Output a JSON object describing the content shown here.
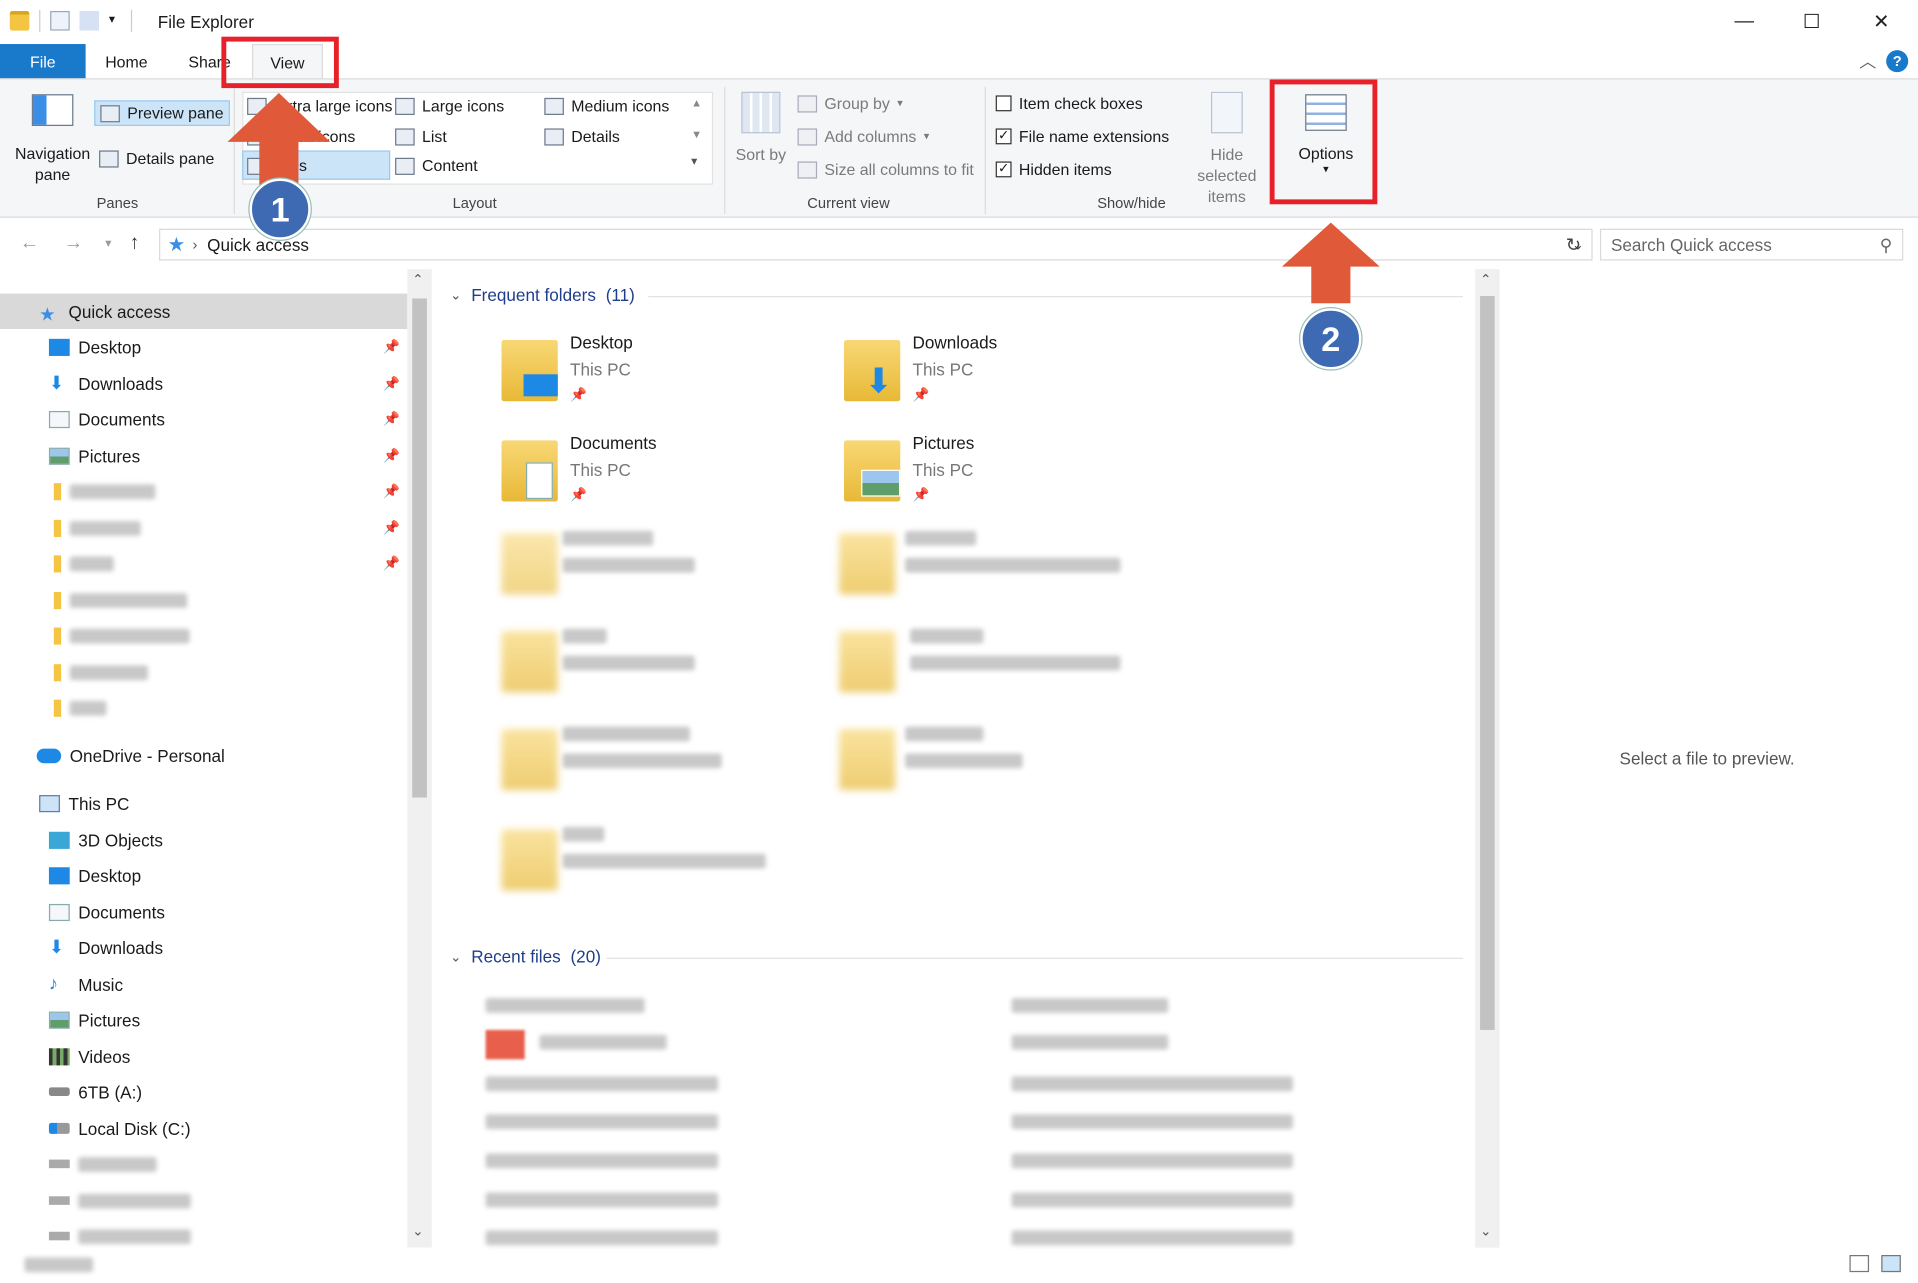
{
  "window": {
    "title": "File Explorer"
  },
  "tabs": {
    "file": "File",
    "home": "Home",
    "share": "Share",
    "view": "View"
  },
  "ribbon": {
    "panes": {
      "label": "Panes",
      "navigation_pane": "Navigation pane",
      "preview_pane": "Preview pane",
      "details_pane": "Details pane"
    },
    "layout": {
      "label": "Layout",
      "items": [
        "Extra large icons",
        "Large icons",
        "Medium icons",
        "Small icons",
        "List",
        "Details",
        "Tiles",
        "Content"
      ]
    },
    "current_view": {
      "label": "Current view",
      "sort_by": "Sort by",
      "group_by": "Group by",
      "add_columns": "Add columns",
      "size_all_columns": "Size all columns to fit"
    },
    "show_hide": {
      "label": "Show/hide",
      "item_check_boxes": {
        "label": "Item check boxes",
        "checked": false
      },
      "file_name_extensions": {
        "label": "File name extensions",
        "checked": true
      },
      "hidden_items": {
        "label": "Hidden items",
        "checked": true
      },
      "hide_selected_items": "Hide selected items"
    },
    "options": "Options"
  },
  "address": {
    "location": "Quick access",
    "search_placeholder": "Search Quick access"
  },
  "nav": {
    "quick_access": "Quick access",
    "quick_items": [
      "Desktop",
      "Downloads",
      "Documents",
      "Pictures"
    ],
    "onedrive": "OneDrive - Personal",
    "this_pc": "This PC",
    "pc_items": [
      "3D Objects",
      "Desktop",
      "Documents",
      "Downloads",
      "Music",
      "Pictures",
      "Videos",
      "6TB (A:)",
      "Local Disk (C:)"
    ]
  },
  "content": {
    "frequent_header": "Frequent folders",
    "frequent_count": "(11)",
    "folders": [
      {
        "name": "Desktop",
        "location": "This PC"
      },
      {
        "name": "Downloads",
        "location": "This PC"
      },
      {
        "name": "Documents",
        "location": "This PC"
      },
      {
        "name": "Pictures",
        "location": "This PC"
      }
    ],
    "recent_header": "Recent files",
    "recent_count": "(20)",
    "preview_message": "Select a file to preview."
  },
  "annotations": {
    "step1": "1",
    "step2": "2",
    "color": "#e8202a",
    "arrow_color": "#e05a3a"
  }
}
